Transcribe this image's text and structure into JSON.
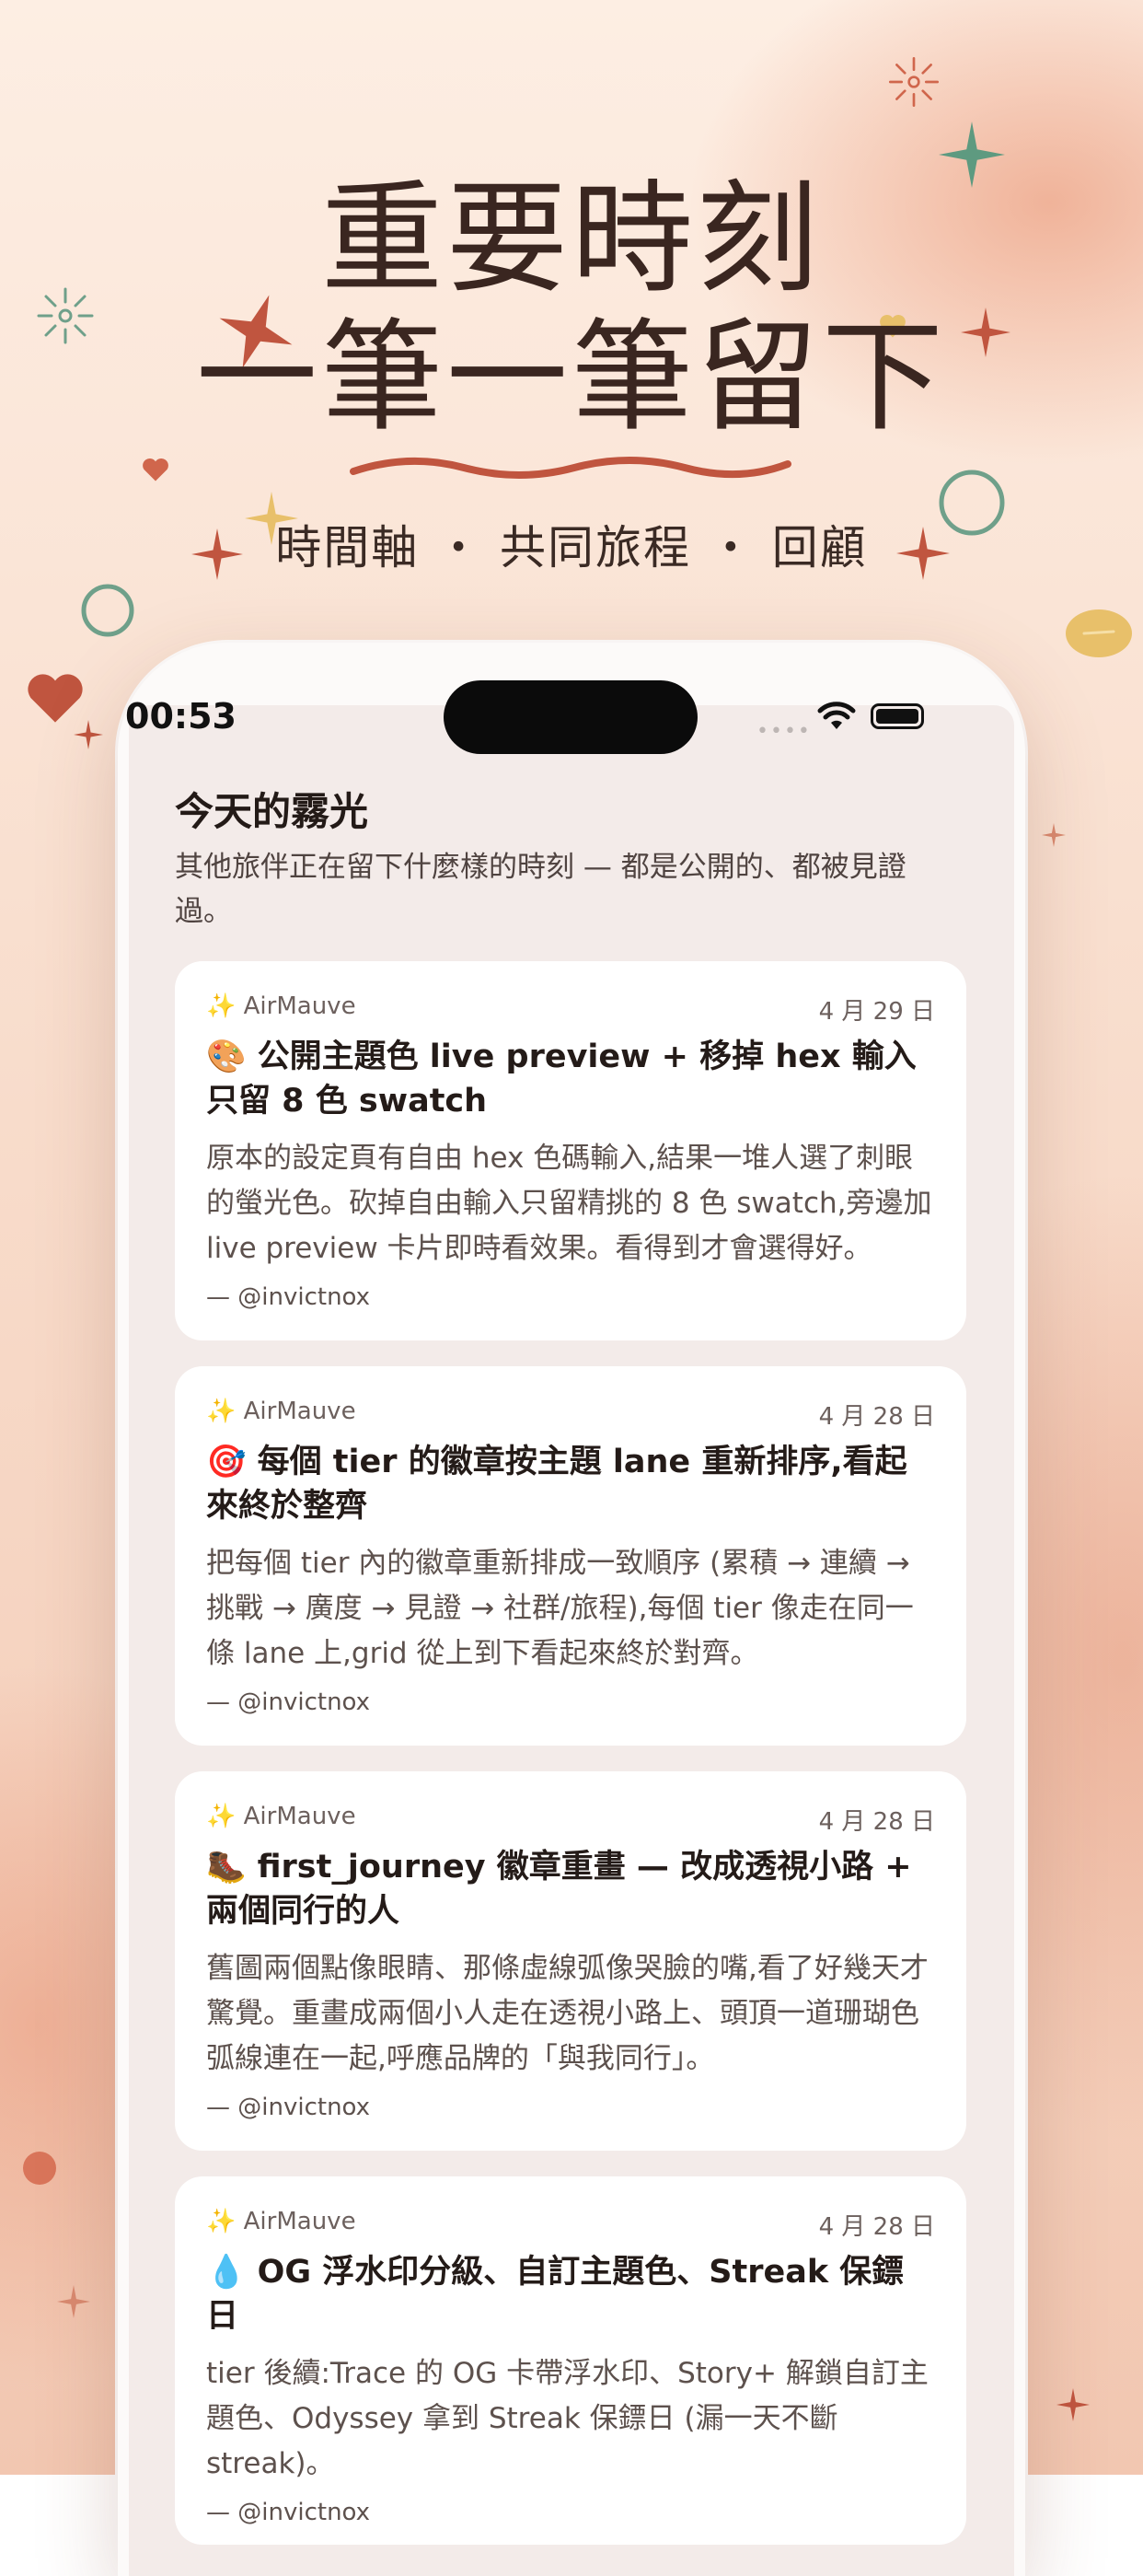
{
  "hero": {
    "headline_line1": "重要時刻",
    "headline_line2": "一筆一筆留下",
    "tagline": "時間軸 ・ 共同旅程 ・ 回顧"
  },
  "status_bar": {
    "time": "00:53"
  },
  "feed": {
    "title": "今天的霧光",
    "subtitle": "其他旅伴正在留下什麼樣的時刻 — 都是公開的、都被見證過。",
    "cards": [
      {
        "user": "✨ AirMauve",
        "date": "4 月 29 日",
        "emoji": "🎨",
        "title": "公開主題色 live preview + 移掉 hex 輸入只留 8 色 swatch",
        "body": "原本的設定頁有自由 hex 色碼輸入,結果一堆人選了刺眼的螢光色。砍掉自由輸入只留精挑的 8 色 swatch,旁邊加 live preview 卡片即時看效果。看得到才會選得好。",
        "author": "— @invictnox"
      },
      {
        "user": "✨ AirMauve",
        "date": "4 月 28 日",
        "emoji": "🎯",
        "title": "每個 tier 的徽章按主題 lane 重新排序,看起來終於整齊",
        "body": "把每個 tier 內的徽章重新排成一致順序 (累積 → 連續 → 挑戰 → 廣度 → 見證 → 社群/旅程),每個 tier 像走在同一條 lane 上,grid 從上到下看起來終於對齊。",
        "author": "— @invictnox"
      },
      {
        "user": "✨ AirMauve",
        "date": "4 月 28 日",
        "emoji": "🥾",
        "title": "first_journey 徽章重畫 — 改成透視小路 + 兩個同行的人",
        "body": "舊圖兩個點像眼睛、那條虛線弧像哭臉的嘴,看了好幾天才驚覺。重畫成兩個小人走在透視小路上、頭頂一道珊瑚色弧線連在一起,呼應品牌的「與我同行」。",
        "author": "— @invictnox"
      },
      {
        "user": "✨ AirMauve",
        "date": "4 月 28 日",
        "emoji": "💧",
        "title": "OG 浮水印分級、自訂主題色、Streak 保鏢日",
        "body": "tier 後續:Trace 的 OG 卡帶浮水印、Story+ 解鎖自訂主題色、Odyssey 拿到 Streak 保鏢日 (漏一天不斷 streak)。",
        "author": "— @invictnox"
      }
    ]
  },
  "colors": {
    "accent_coral": "#c0553f",
    "accent_green": "#6fa08a",
    "accent_gold": "#e8c06a",
    "text_dark": "#3a2620"
  }
}
